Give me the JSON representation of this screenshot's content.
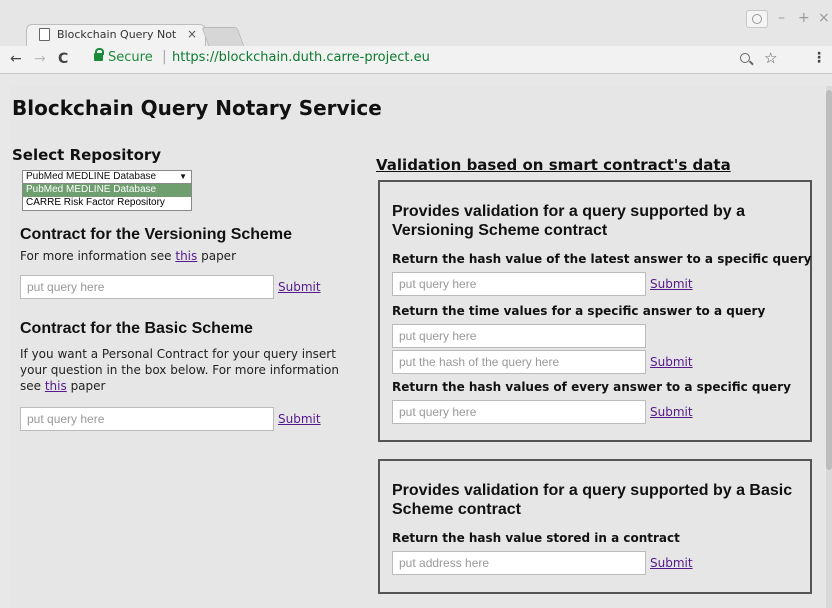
{
  "browser": {
    "tab_title": "Blockchain Query Notar",
    "tab_close": "×",
    "window_controls": [
      "–",
      "+",
      "×"
    ],
    "back": "←",
    "forward": "→",
    "reload": "C",
    "secure_label": "Secure",
    "separator": "|",
    "url": "https://blockchain.duth.carre-project.eu",
    "menu": "⋮",
    "star": "☆"
  },
  "page": {
    "title": "Blockchain Query Notary Service"
  },
  "repository": {
    "heading": "Select Repository",
    "selected": "PubMed MEDLINE Database",
    "options": [
      "PubMed MEDLINE Database",
      "CARRE Risk Factor Repository"
    ]
  },
  "versioning": {
    "heading": "Contract for the Versioning Scheme",
    "info_prefix": "For more information see ",
    "info_link": "this",
    "info_suffix": " paper",
    "query_placeholder": "put query here",
    "submit_label": "Submit"
  },
  "basic": {
    "heading": "Contract for the Basic Scheme",
    "info_prefix": "If you want a Personal Contract for your query insert your question in the box below. For more information see ",
    "info_link": "this",
    "info_suffix": " paper",
    "query_placeholder": "put query here",
    "submit_label": "Submit"
  },
  "validation": {
    "heading": "Validation based on smart contract's data",
    "versioning_box": {
      "heading": "Provides validation for a query supported by a Versioning Scheme contract",
      "latest_label": "Return the hash value of the latest answer to a specific query",
      "latest_placeholder": "put query here",
      "time_label": "Return the time values for a specific answer to a query",
      "time_query_placeholder": "put query here",
      "time_hash_placeholder": "put the hash of the query here",
      "every_label": "Return the hash values of every answer to a specific query",
      "every_placeholder": "put query here",
      "submit_label": "Submit"
    },
    "basic_box": {
      "heading": "Provides validation for a query supported by a Basic Scheme contract",
      "stored_label": "Return the hash value stored in a contract",
      "address_placeholder": "put address here",
      "submit_label": "Submit"
    }
  }
}
